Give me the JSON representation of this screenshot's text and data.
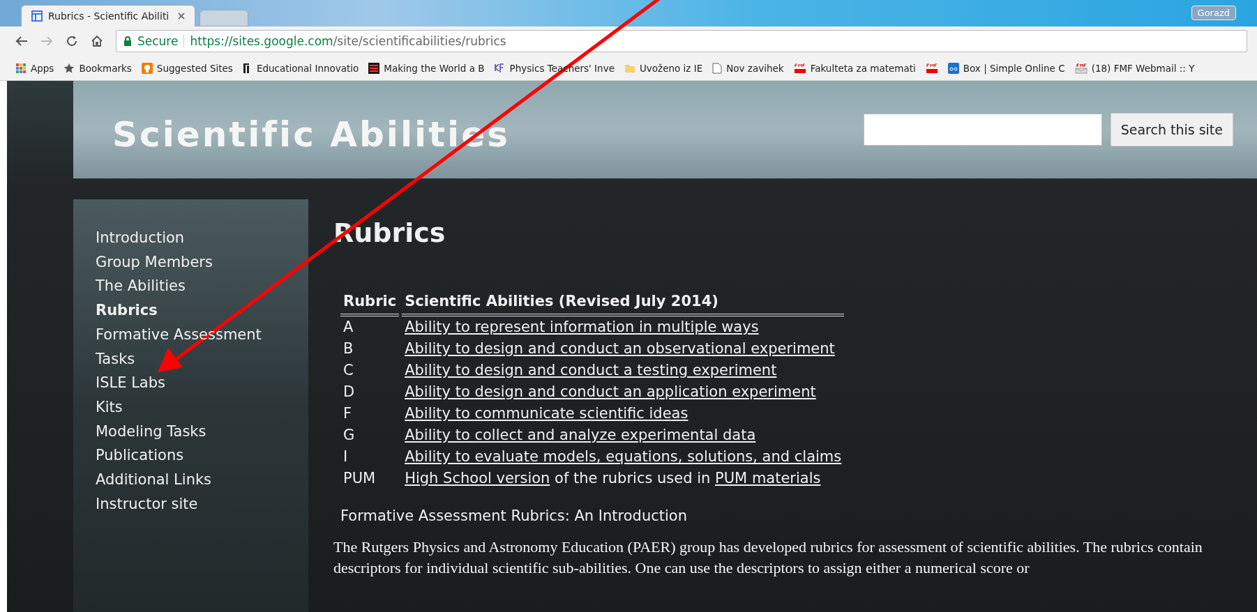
{
  "browser": {
    "tabs": [
      {
        "title": "Rubrics - Scientific Abiliti",
        "selected": true
      },
      {
        "selected": false
      }
    ],
    "profile": "Gorazd",
    "address": {
      "secure_label": "Secure",
      "host": "https://sites.google.com",
      "path": "/site/scientificabilities/rubrics"
    },
    "bookmarks": [
      {
        "kind": "grid",
        "label": "Apps"
      },
      {
        "kind": "star",
        "label": "Bookmarks"
      },
      {
        "kind": "bulb",
        "label": "Suggested Sites"
      },
      {
        "kind": "ei",
        "label": "Educational Innovatio"
      },
      {
        "kind": "redbox",
        "label": "Making the World a B"
      },
      {
        "kind": "kf",
        "label": "Physics Teachers' Inve"
      },
      {
        "kind": "folder",
        "label": "Uvoženo iz IE"
      },
      {
        "kind": "page",
        "label": "Nov zavihek"
      },
      {
        "kind": "fmf",
        "label": "Fakulteta za matemati"
      },
      {
        "kind": "fmf"
      },
      {
        "kind": "box",
        "label": "Box | Simple Online C"
      },
      {
        "kind": "mail",
        "label": "(18) FMF Webmail :: Y"
      }
    ]
  },
  "site": {
    "title": "Scientific Abilities",
    "search": {
      "button": "Search this site"
    },
    "sidebar": {
      "items": [
        {
          "label": "Introduction",
          "selected": false
        },
        {
          "label": "Group Members",
          "selected": false
        },
        {
          "label": "The Abilities",
          "selected": false
        },
        {
          "label": "Rubrics",
          "selected": true
        },
        {
          "label": "Formative Assessment Tasks",
          "selected": false
        },
        {
          "label": "ISLE Labs",
          "selected": false
        },
        {
          "label": "Kits",
          "selected": false
        },
        {
          "label": "Modeling Tasks",
          "selected": false
        },
        {
          "label": "Publications",
          "selected": false
        },
        {
          "label": "Additional Links",
          "selected": false
        },
        {
          "label": "Instructor site",
          "selected": false
        }
      ]
    },
    "heading": "Rubrics",
    "table": {
      "columns": [
        "Rubric",
        "Scientific Abilities (Revised July 2014)"
      ],
      "rows": [
        {
          "rubric": "A",
          "description": [
            {
              "text": "Ability to represent information in multiple ways",
              "link": true
            }
          ]
        },
        {
          "rubric": "B",
          "description": [
            {
              "text": "Ability to design and conduct an observational experiment",
              "link": true
            }
          ]
        },
        {
          "rubric": "C",
          "description": [
            {
              "text": "Ability to design and conduct a testing experiment",
              "link": true
            }
          ]
        },
        {
          "rubric": "D",
          "description": [
            {
              "text": "Ability to design and conduct an application experiment",
              "link": true
            }
          ]
        },
        {
          "rubric": "F",
          "description": [
            {
              "text": "Ability to communicate scientific ideas",
              "link": true
            }
          ]
        },
        {
          "rubric": "G",
          "description": [
            {
              "text": "Ability to collect and analyze experimental data",
              "link": true
            }
          ]
        },
        {
          "rubric": "I",
          "description": [
            {
              "text": "Ability to evaluate models, equations, solutions, and claims",
              "link": true
            }
          ]
        },
        {
          "rubric": "PUM",
          "description": [
            {
              "text": "High School version",
              "link": true
            },
            {
              "text": " of the rubrics used in ",
              "link": false
            },
            {
              "text": "PUM materials",
              "link": true
            }
          ]
        }
      ]
    },
    "subheading": "Formative Assessment Rubrics: An Introduction",
    "paragraph": "The Rutgers Physics and Astronomy Education (PAER) group has developed rubrics for assessment of scientific abilities. The rubrics contain descriptors for individual scientific sub-abilities. One can use the descriptors to assign either a numerical score or"
  },
  "annotation": {
    "kind": "arrow"
  }
}
